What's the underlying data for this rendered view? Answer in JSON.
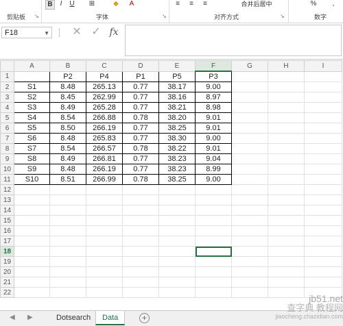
{
  "ribbon": {
    "clipboard_label": "剪贴板",
    "font_label": "字体",
    "alignment_label": "对齐方式",
    "number_label": "数字",
    "bold": "B",
    "italic": "I",
    "underline": "U",
    "merge_center": "合并后居中",
    "percent": "%",
    "comma": ","
  },
  "formula": {
    "name_box": "F18",
    "fx": "fx",
    "value": ""
  },
  "columns": [
    "A",
    "B",
    "C",
    "D",
    "E",
    "F",
    "G",
    "H",
    "I"
  ],
  "selected_column": "F",
  "selected_row": 18,
  "headers": [
    "",
    "P2",
    "P4",
    "P1",
    "P5",
    "P3"
  ],
  "rows": [
    [
      "S1",
      "8.48",
      "265.13",
      "0.77",
      "38.17",
      "9.00"
    ],
    [
      "S2",
      "8.45",
      "262.99",
      "0.77",
      "38.16",
      "8.97"
    ],
    [
      "S3",
      "8.49",
      "265.28",
      "0.77",
      "38.21",
      "8.98"
    ],
    [
      "S4",
      "8.54",
      "266.88",
      "0.78",
      "38.20",
      "9.01"
    ],
    [
      "S5",
      "8.50",
      "266.19",
      "0.77",
      "38.25",
      "9.01"
    ],
    [
      "S6",
      "8.48",
      "265.83",
      "0.77",
      "38.30",
      "9.00"
    ],
    [
      "S7",
      "8.54",
      "266.57",
      "0.78",
      "38.22",
      "9.01"
    ],
    [
      "S8",
      "8.49",
      "266.81",
      "0.77",
      "38.23",
      "9.04"
    ],
    [
      "S9",
      "8.48",
      "266.19",
      "0.77",
      "38.23",
      "8.99"
    ],
    [
      "S10",
      "8.51",
      "266.99",
      "0.78",
      "38.25",
      "9.00"
    ]
  ],
  "row_numbers": [
    1,
    2,
    3,
    4,
    5,
    6,
    7,
    8,
    9,
    10,
    11,
    12,
    13,
    14,
    15,
    16,
    17,
    18,
    19,
    20,
    21,
    22
  ],
  "sheets": [
    {
      "name": "Dotsearch",
      "active": false
    },
    {
      "name": "Data",
      "active": true
    }
  ],
  "watermark": {
    "line1": "jb51.net",
    "line2": "查字典 教程网",
    "line3": "jiaocheng.chazidian.com"
  },
  "colors": {
    "accent": "#217346",
    "header_bg": "#f3f3f3",
    "tab_bar": "#f0f0f0"
  }
}
